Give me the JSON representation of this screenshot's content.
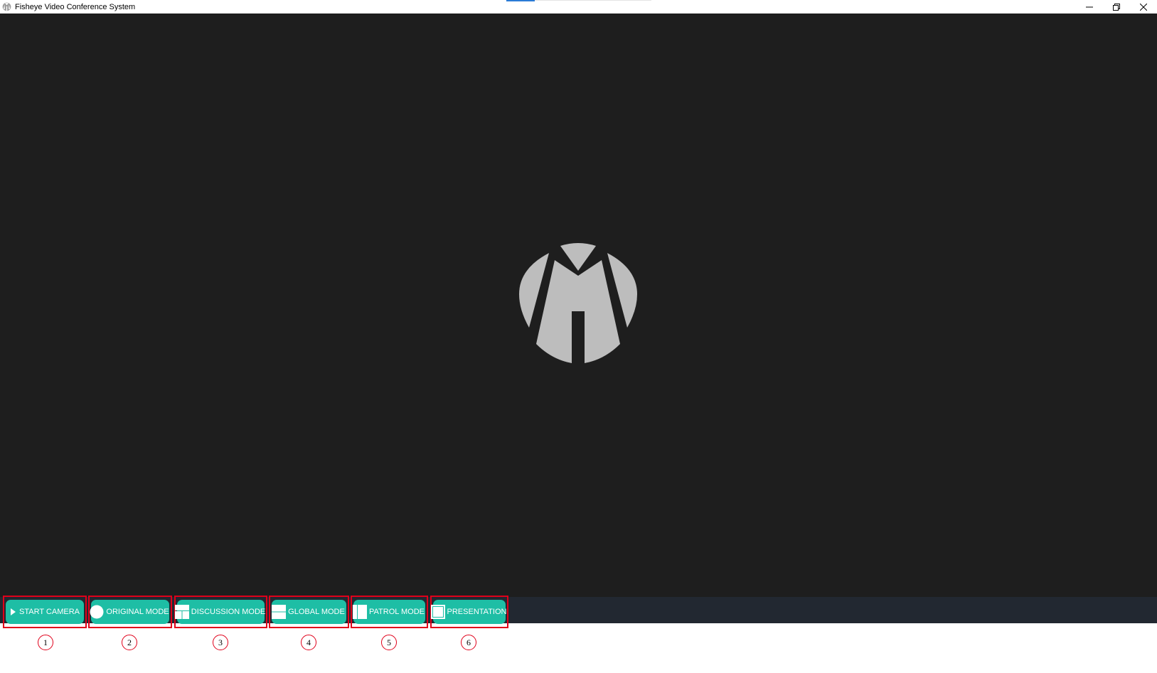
{
  "window": {
    "title": "Fisheye Video Conference System",
    "icon": "app-logo-icon",
    "controls": [
      "minimize-icon",
      "restore-icon",
      "close-icon"
    ]
  },
  "colors": {
    "video_background": "#1e1e1e",
    "toolbar_background": "#222831",
    "button": "#1ebea5",
    "logo": "#bdbdbd",
    "annotation": "#e0001a"
  },
  "toolbar": {
    "buttons": [
      {
        "label": "START CAMERA",
        "icon": "play-icon",
        "number": "1"
      },
      {
        "label": "ORIGINAL MODE",
        "icon": "circle-icon",
        "number": "2"
      },
      {
        "label": "DISCUSSION MODE",
        "icon": "split-layout-icon",
        "number": "3"
      },
      {
        "label": "GLOBAL MODE",
        "icon": "horizontal-split-icon",
        "number": "4"
      },
      {
        "label": "PATROL MODE",
        "icon": "vertical-split-icon",
        "number": "5"
      },
      {
        "label": "PRESENTATION",
        "icon": "square-icon",
        "number": "6"
      }
    ]
  }
}
